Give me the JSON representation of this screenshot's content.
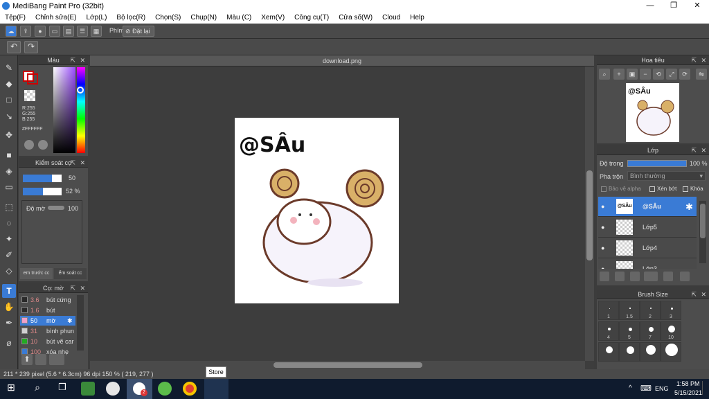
{
  "window": {
    "title": "MediBang Paint Pro (32bit)"
  },
  "menu": [
    "Tệp(F)",
    "Chỉnh sửa(E)",
    "Lớp(L)",
    "Bộ lọc(R)",
    "Chọn(S)",
    "Chụp(N)",
    "Màu (C)",
    "Xem(V)",
    "Công cụ(T)",
    "Cửa số(W)",
    "Cloud",
    "Help"
  ],
  "toolbar": {
    "shortcut_label": "Phím",
    "reset_label": "Đặt lại"
  },
  "color_panel": {
    "title": "Màu",
    "r": "R:255",
    "g": "G:255",
    "b": "B:255",
    "hex": "#FFFFFF"
  },
  "brush_control": {
    "title": "Kiểm soát cọ",
    "size_value": "50",
    "opacity_value": "52 %",
    "blur_label": "Độ mờ",
    "blur_value": "100",
    "tab_preview": "em trước cc",
    "tab_control": "ểm soát cc"
  },
  "brush_list": {
    "title": "Cọ: mờ",
    "items": [
      {
        "size": "3.6",
        "name": "bút cứng",
        "color": "#2a2a2a"
      },
      {
        "size": "1.6",
        "name": "bút",
        "color": "#2a2a2a"
      },
      {
        "size": "50",
        "name": "mờ",
        "color": "#f0a0c8"
      },
      {
        "size": "31",
        "name": "bình phun",
        "color": "#d0d0d0"
      },
      {
        "size": "10",
        "name": "bút vẽ car",
        "color": "#22aa22"
      },
      {
        "size": "100",
        "name": "xóa nhẹ",
        "color": "#3a7bd5"
      }
    ]
  },
  "canvas": {
    "tab_title": "download.png",
    "artwork_caption": "@SÂu"
  },
  "navigator": {
    "title": "Hoa tiêu",
    "thumb_caption": "@SÂu"
  },
  "layer_panel": {
    "title": "Lớp",
    "opacity_label": "Độ trong",
    "opacity_value": "100 %",
    "blend_label": "Pha trộn",
    "blend_value": "Bình thường",
    "protect_alpha": "Bảo vệ alpha",
    "clipping": "Xén bớt",
    "lock": "Khóa",
    "layers": [
      {
        "name": "@SÂu",
        "thumb": "@SÂu",
        "selected": true
      },
      {
        "name": "Lớp5",
        "selected": false
      },
      {
        "name": "Lớp4",
        "selected": false
      },
      {
        "name": "Lớp3",
        "selected": false
      }
    ]
  },
  "brush_size": {
    "title": "Brush Size",
    "labels": [
      "1",
      "1.5",
      "2",
      "3",
      "4",
      "5",
      "7",
      "10",
      "",
      "",
      "",
      ""
    ]
  },
  "status": {
    "size_text": "211 * 239 pixel   (5.6 * 6.3cm)   96 dpi   150 %   ( 219, 277 )",
    "tooltip": "Store"
  },
  "taskbar": {
    "lang": "ENG",
    "time": "1:58 PM",
    "date": "5/15/2021",
    "badge": "2"
  }
}
